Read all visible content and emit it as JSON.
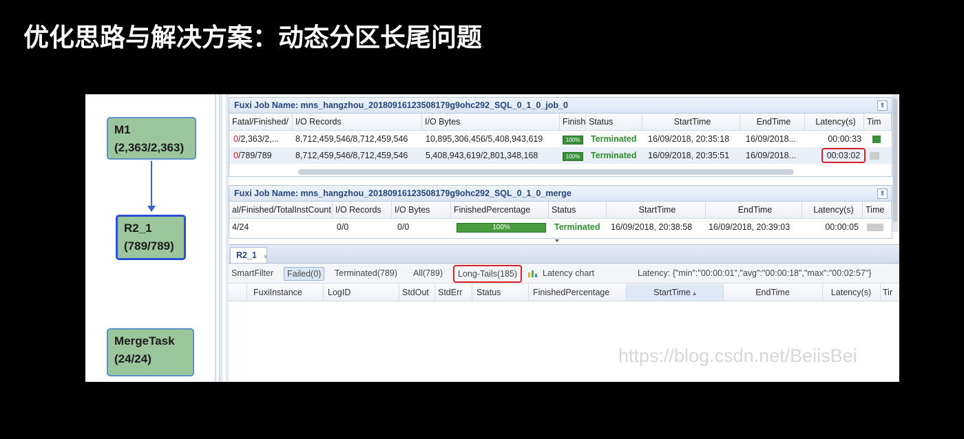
{
  "slide": {
    "title": "优化思路与解决方案：动态分区长尾问题"
  },
  "dag": {
    "nodes": [
      {
        "name": "M1",
        "count": "(2,363/2,363)"
      },
      {
        "name": "R2_1",
        "count": "(789/789)"
      },
      {
        "name": "MergeTask",
        "count": "(24/24)"
      }
    ]
  },
  "job_panel_1": {
    "title": "Fuxi Job Name: mns_hangzhou_20180916123508179g9ohc292_SQL_0_1_0_job_0",
    "columns": [
      "Fatal/Finished/",
      "I/O Records",
      "I/O Bytes",
      "Finish",
      "Status",
      "StartTime",
      "EndTime",
      "Latency(s)",
      "Tim"
    ],
    "rows": [
      {
        "fatal": "0",
        "finished": "/2,363/2,...",
        "records": "8,712,459,546/8,712,459,546",
        "bytes": "10,895,306,456/5,408,943,619",
        "finish": "100%",
        "status": "Terminated",
        "start": "16/09/2018, 20:35:18",
        "end": "16/09/2018...",
        "latency": "00:00:33"
      },
      {
        "fatal": "0",
        "finished": "/789/789",
        "records": "8,712,459,546/8,712,459,546",
        "bytes": "5,408,943,619/2,801,348,168",
        "finish": "100%",
        "status": "Terminated",
        "start": "16/09/2018, 20:35:51",
        "end": "16/09/2018...",
        "latency": "00:03:02"
      }
    ]
  },
  "job_panel_2": {
    "title": "Fuxi Job Name: mns_hangzhou_20180916123508179g9ohc292_SQL_0_1_0_merge",
    "columns": [
      "al/Finished/TotalInstCount",
      "I/O Records",
      "I/O Bytes",
      "FinishedPercentage",
      "Status",
      "StartTime",
      "EndTime",
      "Latency(s)",
      "Time"
    ],
    "rows": [
      {
        "finished": "4/24",
        "records": "0/0",
        "bytes": "0/0",
        "finish": "100%",
        "status": "Terminated",
        "start": "16/09/2018, 20:38:58",
        "end": "16/09/2018, 20:39:03",
        "latency": "00:00:05"
      }
    ]
  },
  "task_tab": {
    "label": "R2_1",
    "close": "×"
  },
  "filters": {
    "smart": "SmartFilter",
    "failed": "Failed(0)",
    "terminated": "Terminated(789)",
    "all": "All(789)",
    "longtails": "Long-Tails(185)",
    "latency_chart": "Latency chart",
    "latency_summary": "Latency: {\"min\":\"00:00:01\",\"avg\":\"00:00:18\",\"max\":\"00:02:57\"}"
  },
  "instance_grid": {
    "columns": [
      "FuxiInstance",
      "LogID",
      "StdOut",
      "StdErr",
      "Status",
      "FinishedPercentage",
      "StartTime",
      "EndTime",
      "Latency(s)",
      "Tir"
    ],
    "sort_indicator": "▴"
  },
  "watermark": "https://blog.csdn.net/BeiisBei",
  "colors": {
    "node_fill": "#9bc69b",
    "terminated": "#2e8b2e",
    "highlight": "#d8202a",
    "header_text": "#26477a"
  }
}
